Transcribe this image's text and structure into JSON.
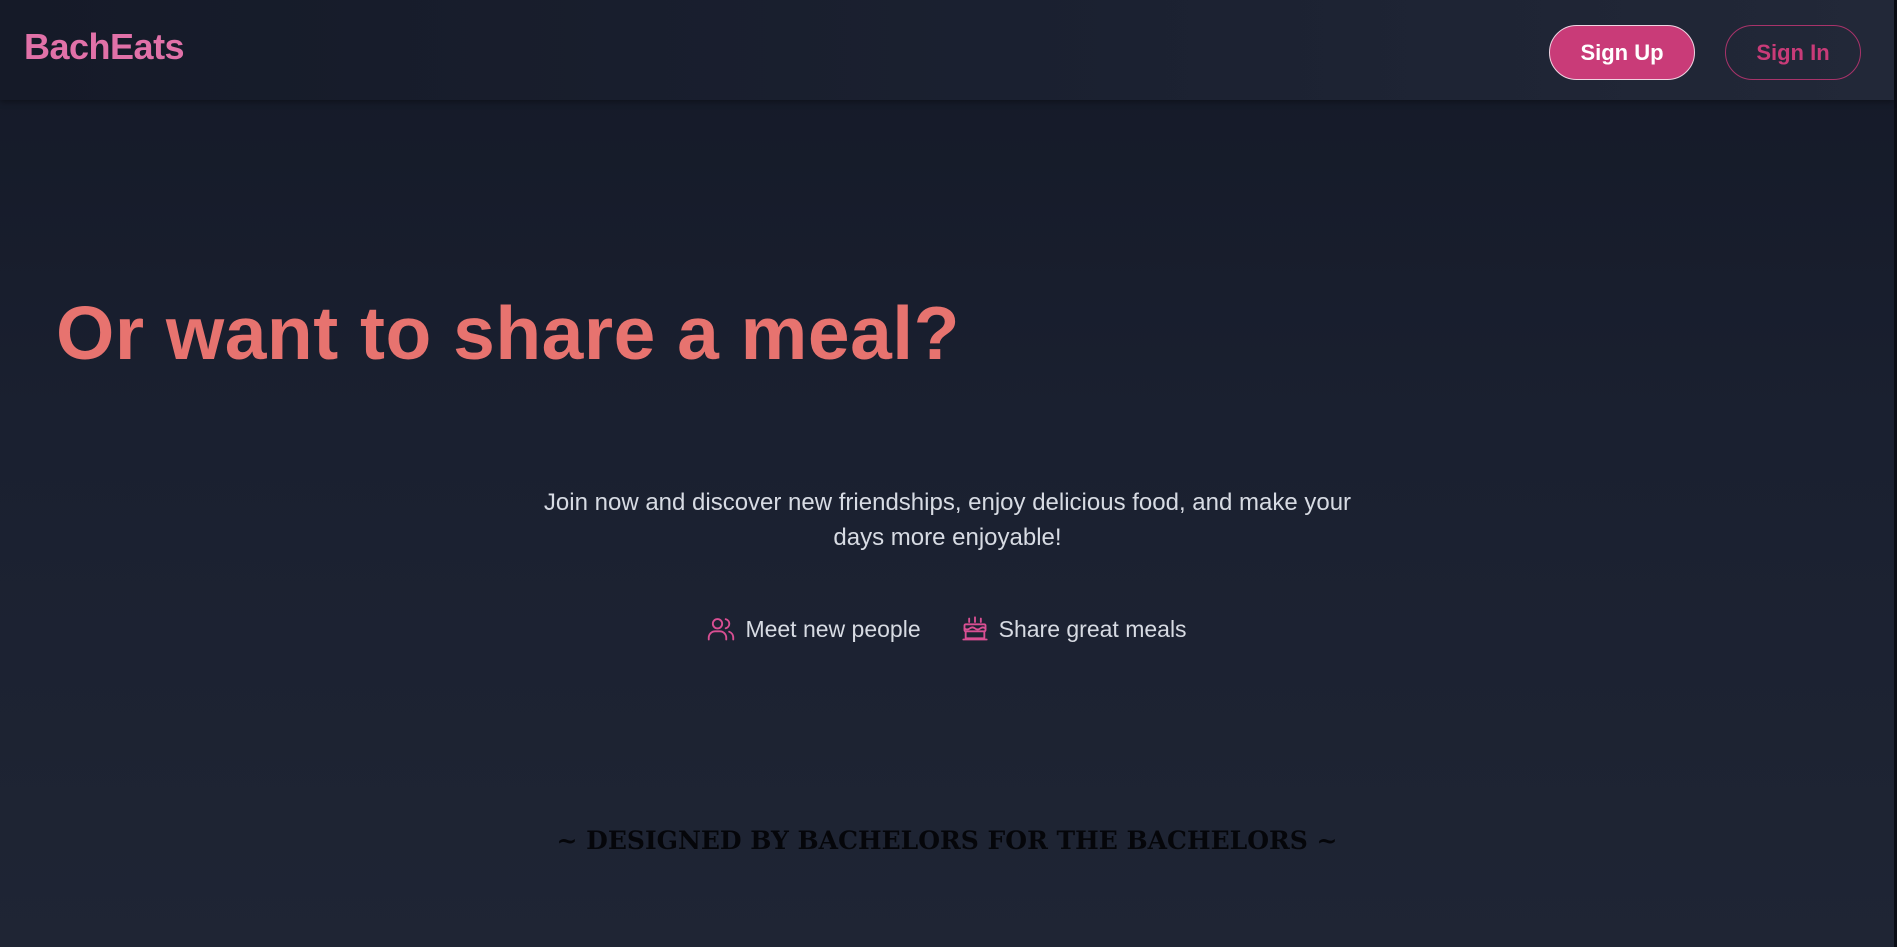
{
  "navbar": {
    "brand": "BachEats",
    "signup_label": "Sign Up",
    "signin_label": "Sign In"
  },
  "hero": {
    "headline": "Or want to share a meal?",
    "subtext": "Join now and discover new friendships, enjoy delicious food, and make your days more enjoyable!",
    "features": [
      {
        "icon": "users-icon",
        "label": "Meet new people"
      },
      {
        "icon": "cake-icon",
        "label": "Share great meals"
      }
    ]
  },
  "footer": {
    "tagline": "~ DESIGNED BY BACHELORS FOR THE BACHELORS ~"
  },
  "colors": {
    "brand": "#e171a8",
    "accent": "#c93b78",
    "headline": "#e7736f",
    "text": "#d7dbe3",
    "background": "#1a2030"
  }
}
